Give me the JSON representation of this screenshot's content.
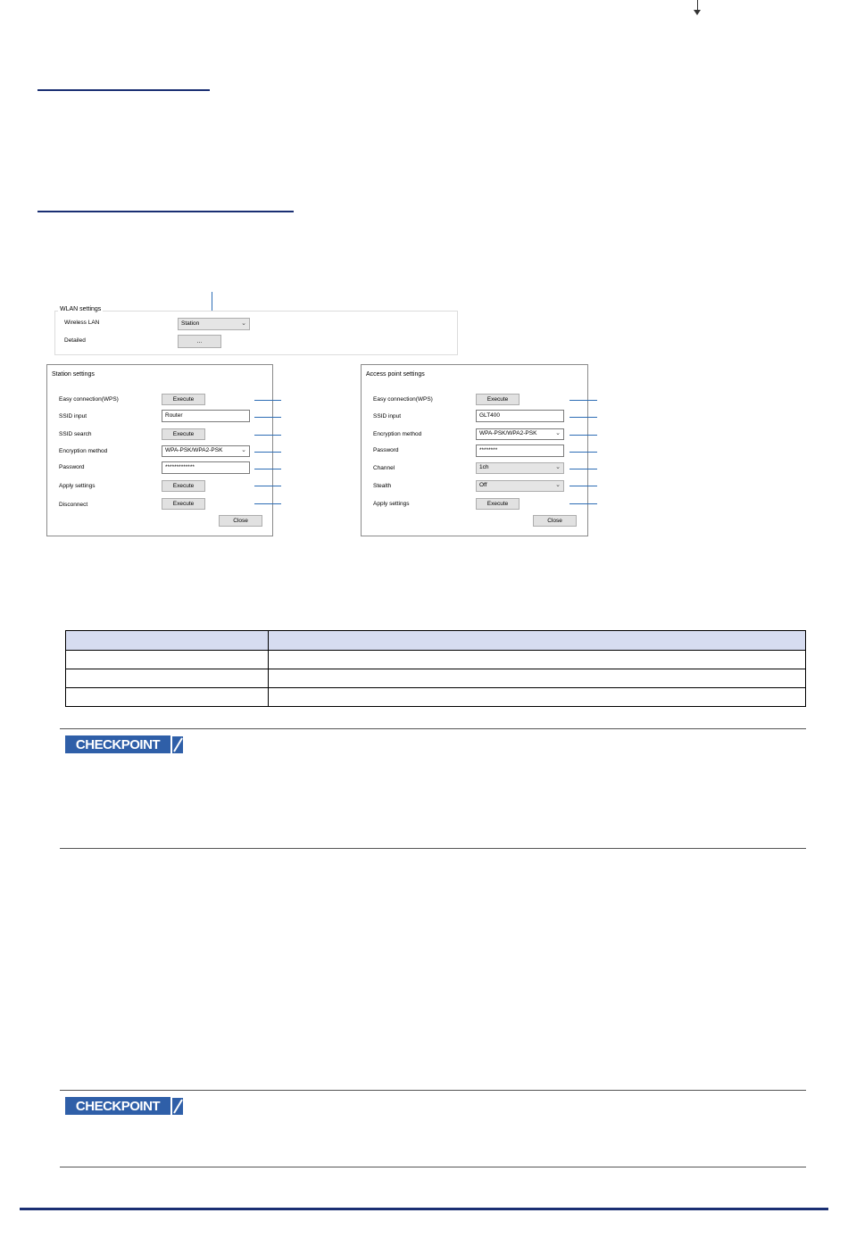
{
  "wlan": {
    "title": "WLAN settings",
    "wireless_lan_label": "Wireless LAN",
    "wireless_lan_value": "Station",
    "detailed_label": "Detailed",
    "detailed_button": "..."
  },
  "station": {
    "title": "Station settings",
    "rows": [
      {
        "label": "Easy connection(WPS)",
        "control": "Execute"
      },
      {
        "label": "SSID input",
        "control": "Router"
      },
      {
        "label": "SSID search",
        "control": "Execute"
      },
      {
        "label": "Encryption method",
        "control": "WPA-PSK/WPA2-PSK"
      },
      {
        "label": "Password",
        "control": "*************"
      },
      {
        "label": "Apply settings",
        "control": "Execute"
      },
      {
        "label": "Disconnect",
        "control": "Execute"
      }
    ],
    "close_button": "Close"
  },
  "access_point": {
    "title": "Access point settings",
    "rows": [
      {
        "label": "Easy connection(WPS)",
        "control": "Execute"
      },
      {
        "label": "SSID input",
        "control": "GLT400"
      },
      {
        "label": "Encryption method",
        "control": "WPA-PSK/WPA2-PSK"
      },
      {
        "label": "Password",
        "control": "********"
      },
      {
        "label": "Channel",
        "control": "1ch"
      },
      {
        "label": "Stealth",
        "control": "Off"
      },
      {
        "label": "Apply settings",
        "control": "Execute"
      }
    ],
    "close_button": "Close"
  },
  "checkpoint": {
    "label": "CHECKPOINT"
  },
  "icons": {
    "dropdown": "chevron-down-icon",
    "checkpoint_pen": "pen-icon"
  },
  "colors": {
    "accent": "#1a2f73",
    "callout": "#2d6db5",
    "table_header": "#d6dcf0"
  }
}
